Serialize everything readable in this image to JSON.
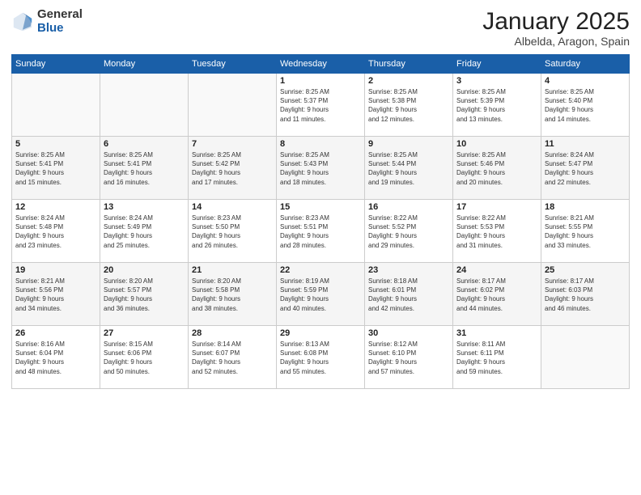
{
  "logo": {
    "general": "General",
    "blue": "Blue"
  },
  "title": {
    "month": "January 2025",
    "location": "Albelda, Aragon, Spain"
  },
  "weekdays": [
    "Sunday",
    "Monday",
    "Tuesday",
    "Wednesday",
    "Thursday",
    "Friday",
    "Saturday"
  ],
  "weeks": [
    [
      {
        "day": "",
        "info": ""
      },
      {
        "day": "",
        "info": ""
      },
      {
        "day": "",
        "info": ""
      },
      {
        "day": "1",
        "info": "Sunrise: 8:25 AM\nSunset: 5:37 PM\nDaylight: 9 hours\nand 11 minutes."
      },
      {
        "day": "2",
        "info": "Sunrise: 8:25 AM\nSunset: 5:38 PM\nDaylight: 9 hours\nand 12 minutes."
      },
      {
        "day": "3",
        "info": "Sunrise: 8:25 AM\nSunset: 5:39 PM\nDaylight: 9 hours\nand 13 minutes."
      },
      {
        "day": "4",
        "info": "Sunrise: 8:25 AM\nSunset: 5:40 PM\nDaylight: 9 hours\nand 14 minutes."
      }
    ],
    [
      {
        "day": "5",
        "info": "Sunrise: 8:25 AM\nSunset: 5:41 PM\nDaylight: 9 hours\nand 15 minutes."
      },
      {
        "day": "6",
        "info": "Sunrise: 8:25 AM\nSunset: 5:41 PM\nDaylight: 9 hours\nand 16 minutes."
      },
      {
        "day": "7",
        "info": "Sunrise: 8:25 AM\nSunset: 5:42 PM\nDaylight: 9 hours\nand 17 minutes."
      },
      {
        "day": "8",
        "info": "Sunrise: 8:25 AM\nSunset: 5:43 PM\nDaylight: 9 hours\nand 18 minutes."
      },
      {
        "day": "9",
        "info": "Sunrise: 8:25 AM\nSunset: 5:44 PM\nDaylight: 9 hours\nand 19 minutes."
      },
      {
        "day": "10",
        "info": "Sunrise: 8:25 AM\nSunset: 5:46 PM\nDaylight: 9 hours\nand 20 minutes."
      },
      {
        "day": "11",
        "info": "Sunrise: 8:24 AM\nSunset: 5:47 PM\nDaylight: 9 hours\nand 22 minutes."
      }
    ],
    [
      {
        "day": "12",
        "info": "Sunrise: 8:24 AM\nSunset: 5:48 PM\nDaylight: 9 hours\nand 23 minutes."
      },
      {
        "day": "13",
        "info": "Sunrise: 8:24 AM\nSunset: 5:49 PM\nDaylight: 9 hours\nand 25 minutes."
      },
      {
        "day": "14",
        "info": "Sunrise: 8:23 AM\nSunset: 5:50 PM\nDaylight: 9 hours\nand 26 minutes."
      },
      {
        "day": "15",
        "info": "Sunrise: 8:23 AM\nSunset: 5:51 PM\nDaylight: 9 hours\nand 28 minutes."
      },
      {
        "day": "16",
        "info": "Sunrise: 8:22 AM\nSunset: 5:52 PM\nDaylight: 9 hours\nand 29 minutes."
      },
      {
        "day": "17",
        "info": "Sunrise: 8:22 AM\nSunset: 5:53 PM\nDaylight: 9 hours\nand 31 minutes."
      },
      {
        "day": "18",
        "info": "Sunrise: 8:21 AM\nSunset: 5:55 PM\nDaylight: 9 hours\nand 33 minutes."
      }
    ],
    [
      {
        "day": "19",
        "info": "Sunrise: 8:21 AM\nSunset: 5:56 PM\nDaylight: 9 hours\nand 34 minutes."
      },
      {
        "day": "20",
        "info": "Sunrise: 8:20 AM\nSunset: 5:57 PM\nDaylight: 9 hours\nand 36 minutes."
      },
      {
        "day": "21",
        "info": "Sunrise: 8:20 AM\nSunset: 5:58 PM\nDaylight: 9 hours\nand 38 minutes."
      },
      {
        "day": "22",
        "info": "Sunrise: 8:19 AM\nSunset: 5:59 PM\nDaylight: 9 hours\nand 40 minutes."
      },
      {
        "day": "23",
        "info": "Sunrise: 8:18 AM\nSunset: 6:01 PM\nDaylight: 9 hours\nand 42 minutes."
      },
      {
        "day": "24",
        "info": "Sunrise: 8:17 AM\nSunset: 6:02 PM\nDaylight: 9 hours\nand 44 minutes."
      },
      {
        "day": "25",
        "info": "Sunrise: 8:17 AM\nSunset: 6:03 PM\nDaylight: 9 hours\nand 46 minutes."
      }
    ],
    [
      {
        "day": "26",
        "info": "Sunrise: 8:16 AM\nSunset: 6:04 PM\nDaylight: 9 hours\nand 48 minutes."
      },
      {
        "day": "27",
        "info": "Sunrise: 8:15 AM\nSunset: 6:06 PM\nDaylight: 9 hours\nand 50 minutes."
      },
      {
        "day": "28",
        "info": "Sunrise: 8:14 AM\nSunset: 6:07 PM\nDaylight: 9 hours\nand 52 minutes."
      },
      {
        "day": "29",
        "info": "Sunrise: 8:13 AM\nSunset: 6:08 PM\nDaylight: 9 hours\nand 55 minutes."
      },
      {
        "day": "30",
        "info": "Sunrise: 8:12 AM\nSunset: 6:10 PM\nDaylight: 9 hours\nand 57 minutes."
      },
      {
        "day": "31",
        "info": "Sunrise: 8:11 AM\nSunset: 6:11 PM\nDaylight: 9 hours\nand 59 minutes."
      },
      {
        "day": "",
        "info": ""
      }
    ]
  ]
}
